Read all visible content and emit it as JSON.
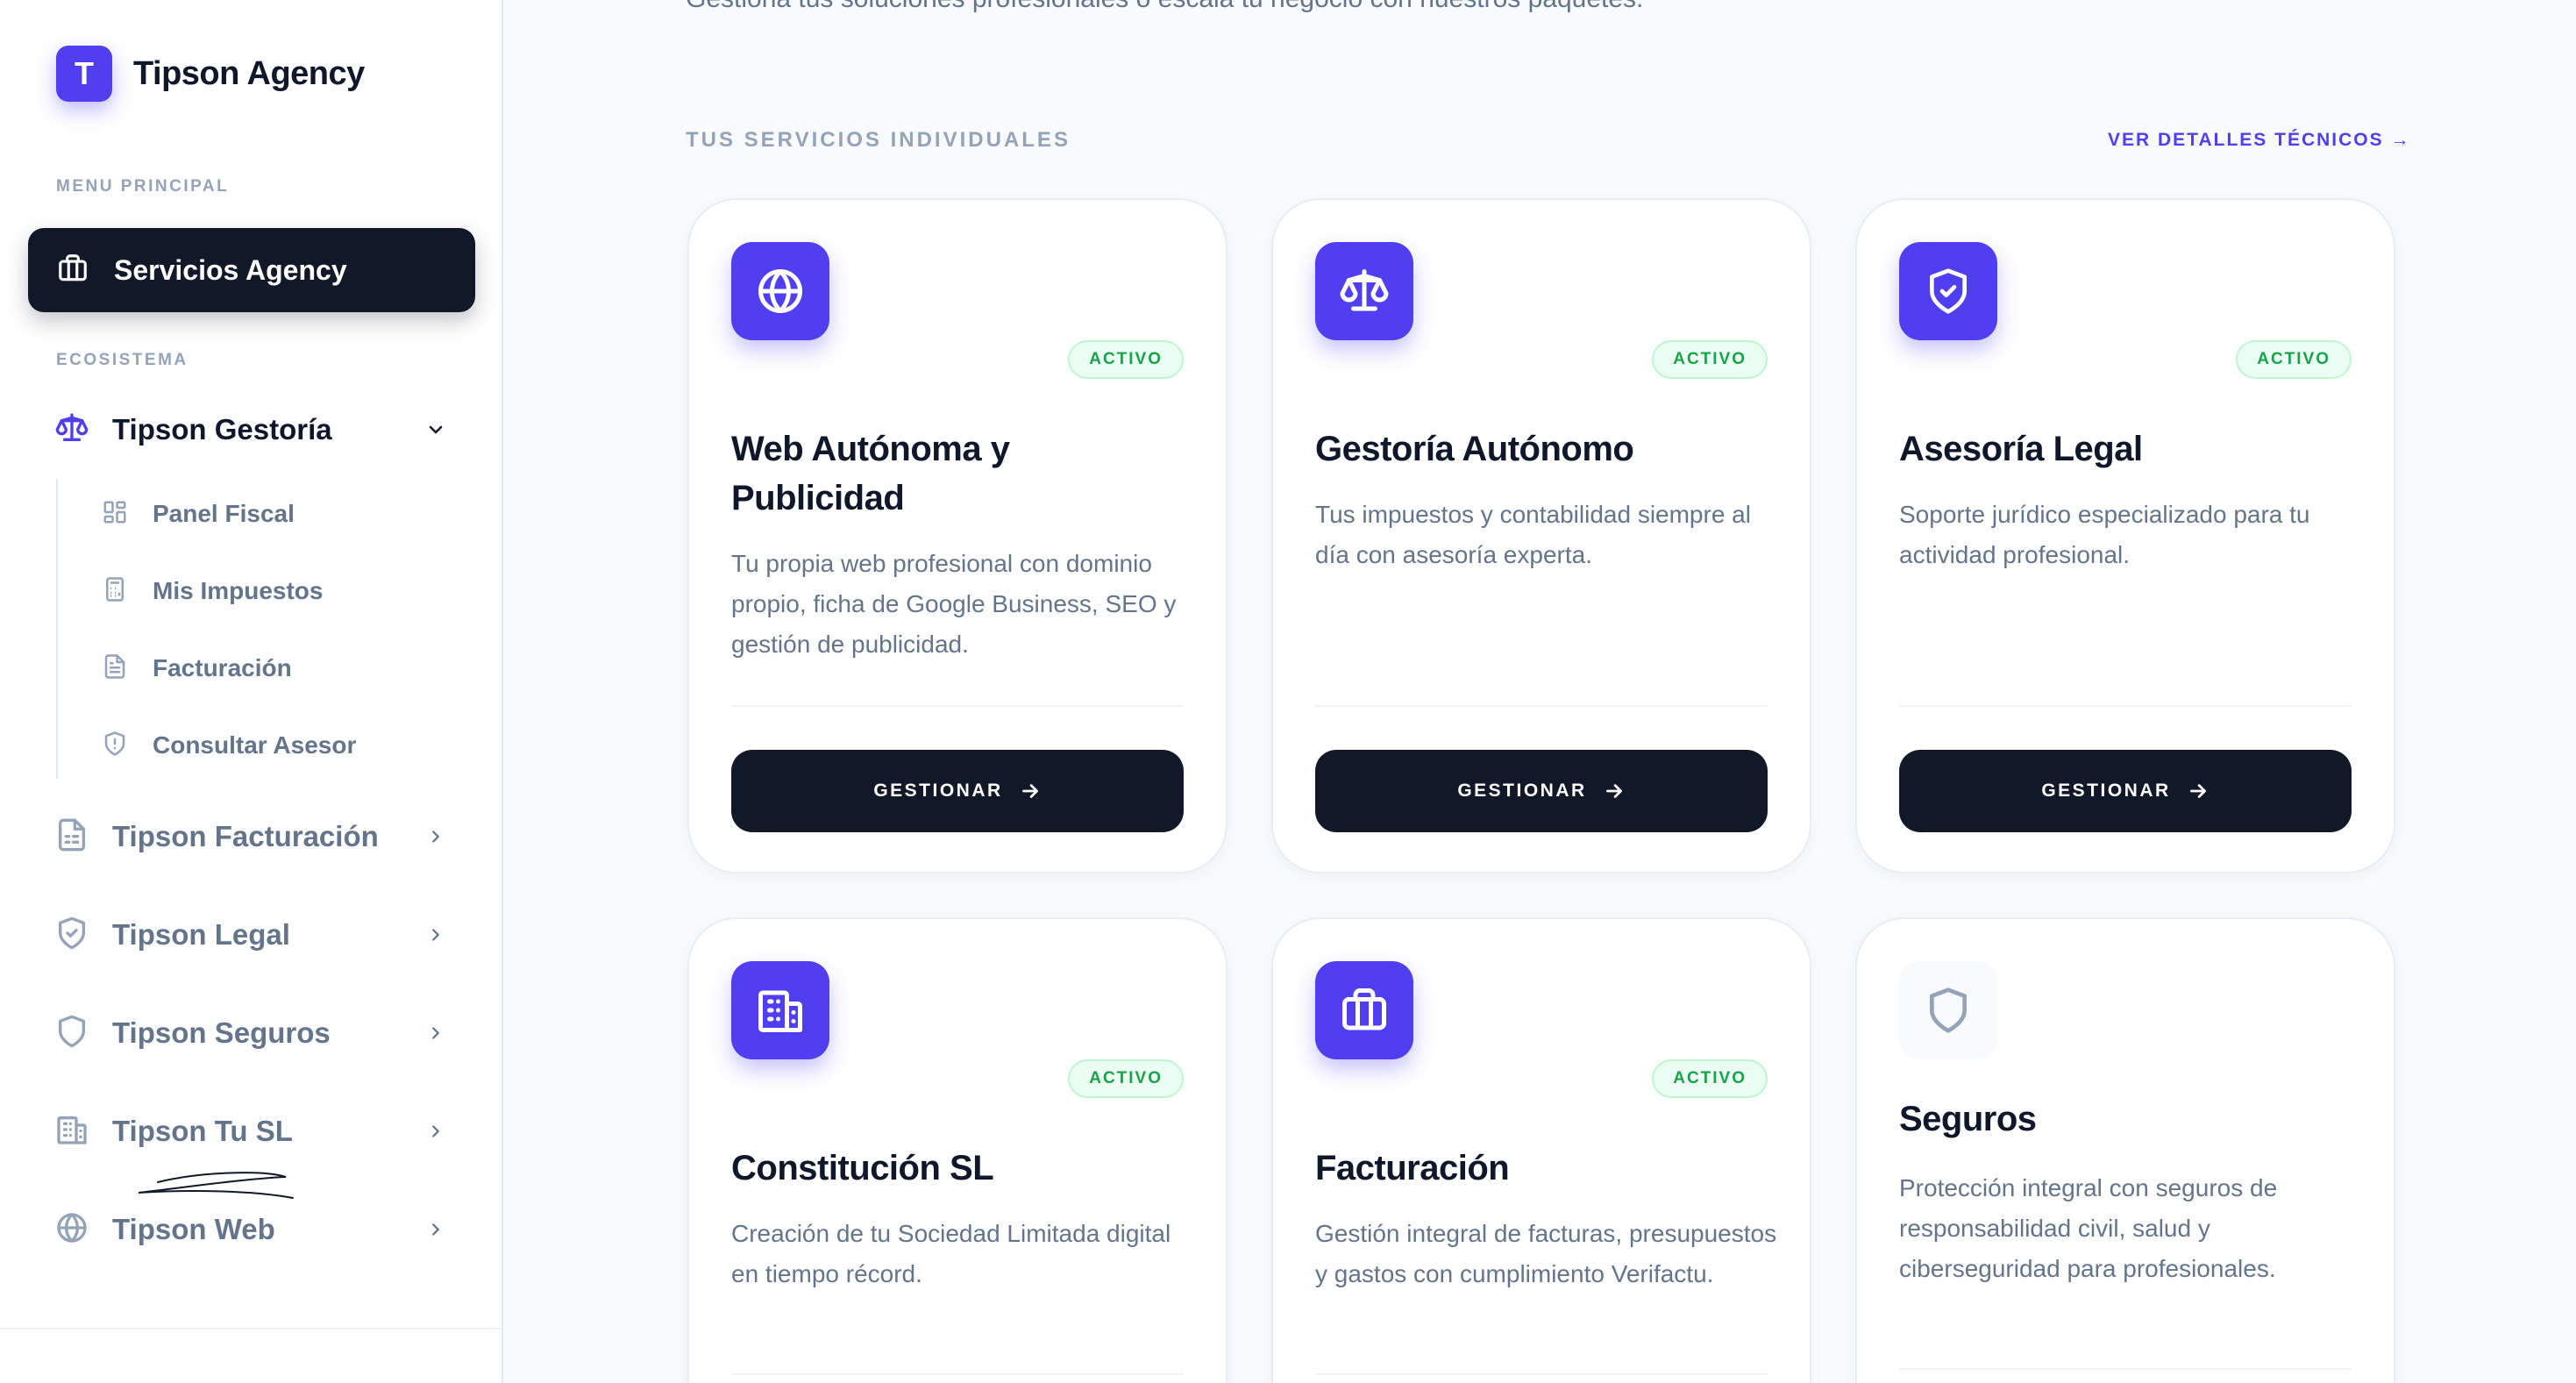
{
  "brand": {
    "logo_letter": "T",
    "name": "Tipson Agency"
  },
  "sidebar": {
    "menu_label": "MENU PRINCIPAL",
    "active_item": {
      "label": "Servicios Agency",
      "icon": "briefcase-icon"
    },
    "ecosystem_label": "ECOSISTEMA",
    "groups": [
      {
        "label": "Tipson Gestoría",
        "icon": "scale-icon",
        "expanded": true,
        "children": [
          {
            "label": "Panel Fiscal",
            "icon": "grid-icon"
          },
          {
            "label": "Mis Impuestos",
            "icon": "calculator-icon"
          },
          {
            "label": "Facturación",
            "icon": "document-icon"
          },
          {
            "label": "Consultar Asesor",
            "icon": "shield-icon"
          }
        ]
      },
      {
        "label": "Tipson Facturación",
        "icon": "receipt-icon",
        "expanded": false
      },
      {
        "label": "Tipson Legal",
        "icon": "shield-check-icon",
        "expanded": false
      },
      {
        "label": "Tipson Seguros",
        "icon": "shield-icon",
        "expanded": false
      },
      {
        "label": "Tipson Tu SL",
        "icon": "building-icon",
        "expanded": false
      },
      {
        "label": "Tipson Web",
        "icon": "globe-icon",
        "expanded": false
      }
    ]
  },
  "main": {
    "intro_text": "Gestiona tus soluciones profesionales o escala tu negocio con nuestros paquetes.",
    "section_title": "TUS SERVICIOS INDIVIDUALES",
    "details_link": "VER DETALLES TÉCNICOS →",
    "cards": [
      {
        "title": "Web Autónoma y Publicidad",
        "icon": "globe-icon",
        "badge": "ACTIVO",
        "description": "Tu propia web profesional con dominio propio, ficha de Google Business, SEO y gestión de publicidad.",
        "button": "GESTIONAR"
      },
      {
        "title": "Gestoría Autónomo",
        "icon": "scale-icon",
        "badge": "ACTIVO",
        "description": "Tus impuestos y contabilidad siempre al día con asesoría experta.",
        "button": "GESTIONAR"
      },
      {
        "title": "Asesoría Legal",
        "icon": "shield-check-icon",
        "badge": "ACTIVO",
        "description": "Soporte jurídico especializado para tu actividad profesional.",
        "button": "GESTIONAR"
      },
      {
        "title": "Constitución SL",
        "icon": "building-icon",
        "badge": "ACTIVO",
        "description": "Creación de tu Sociedad Limitada digital en tiempo récord."
      },
      {
        "title": "Facturación",
        "icon": "briefcase-icon",
        "badge": "ACTIVO",
        "description": "Gestión integral de facturas, presupuestos y gastos con cumplimiento Verifactu."
      },
      {
        "title": "Seguros",
        "icon": "shield-icon",
        "description": "Protección integral con seguros de responsabilidad civil, salud y ciberseguridad para profesionales."
      }
    ]
  },
  "colors": {
    "accent": "#4f3ff0",
    "dark": "#111827",
    "badge_green": "#16a34a",
    "muted_text": "#64748b"
  }
}
